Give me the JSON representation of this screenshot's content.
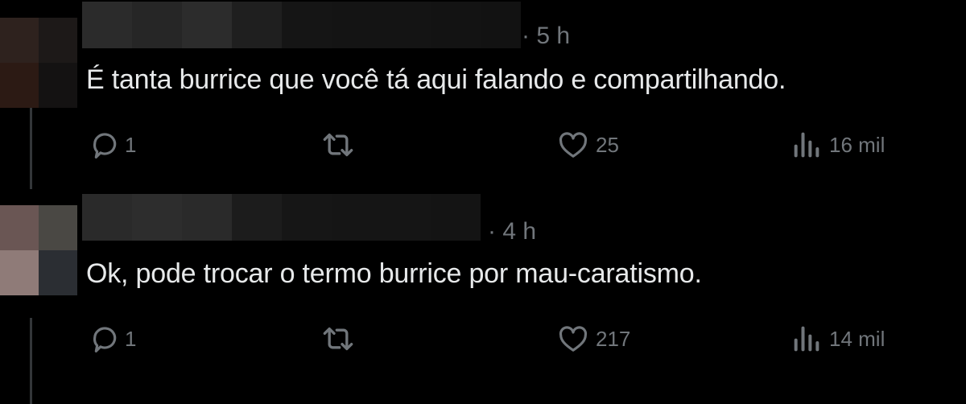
{
  "tweets": [
    {
      "time": "· 5 h",
      "text": "É tanta burrice que você tá aqui falando e compartilhando.",
      "avatar_icon": "blurred-avatar",
      "actions": {
        "reply": {
          "icon": "reply-icon",
          "count": "1"
        },
        "retweet": {
          "icon": "retweet-icon",
          "count": ""
        },
        "like": {
          "icon": "heart-icon",
          "count": "25"
        },
        "views": {
          "icon": "views-icon",
          "count": "16 mil"
        }
      }
    },
    {
      "time": "· 4 h",
      "text": "Ok, pode trocar o termo burrice por mau-caratismo.",
      "avatar_icon": "blurred-avatar",
      "actions": {
        "reply": {
          "icon": "reply-icon",
          "count": "1"
        },
        "retweet": {
          "icon": "retweet-icon",
          "count": ""
        },
        "like": {
          "icon": "heart-icon",
          "count": "217"
        },
        "views": {
          "icon": "views-icon",
          "count": "14 mil"
        }
      }
    }
  ],
  "colors": {
    "background": "#000000",
    "text": "#e7e9ea",
    "secondary": "#71767b",
    "thread_line": "#333639"
  }
}
